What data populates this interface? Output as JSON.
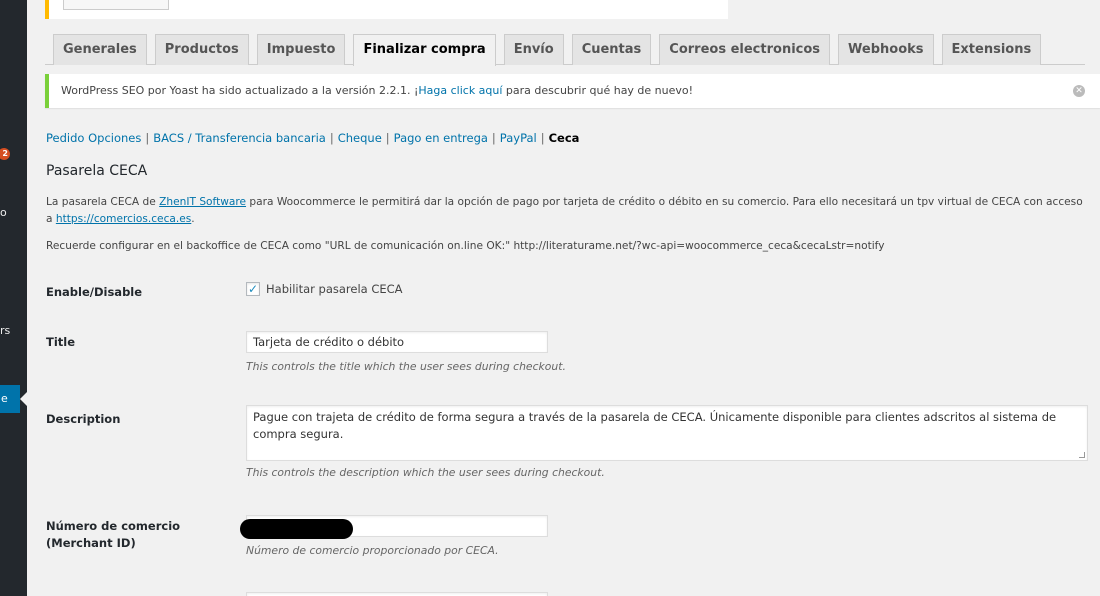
{
  "sidebar": {
    "badge_count": "2",
    "fragments": [
      "o",
      "rs"
    ],
    "active_fragment": "e"
  },
  "tabs": [
    {
      "label": "Generales",
      "active": false
    },
    {
      "label": "Productos",
      "active": false
    },
    {
      "label": "Impuesto",
      "active": false
    },
    {
      "label": "Finalizar compra",
      "active": true
    },
    {
      "label": "Envío",
      "active": false
    },
    {
      "label": "Cuentas",
      "active": false
    },
    {
      "label": "Correos electronicos",
      "active": false
    },
    {
      "label": "Webhooks",
      "active": false
    },
    {
      "label": "Extensions",
      "active": false
    }
  ],
  "notice": {
    "before": "WordPress SEO por Yoast ha sido actualizado a la versión 2.2.1. ¡",
    "link": "Haga click aquí",
    "after": " para descubrir qué hay de nuevo!",
    "dismiss_icon": "dismiss-icon",
    "border_color": "#7ad03a"
  },
  "subnav": {
    "items": [
      "Pedido Opciones",
      "BACS / Transferencia bancaria",
      "Cheque",
      "Pago en entrega",
      "PayPal"
    ],
    "current": "Ceca",
    "separator": "|"
  },
  "heading": "Pasarela CECA",
  "intro": {
    "p1_before": "La pasarela CECA de ",
    "p1_link": "ZhenIT Software",
    "p1_middle": " para Woocommerce le permitirá dar la opción de pago por tarjeta de crédito o débito en su comercio. Para ello necesitará un tpv virtual de CECA con acceso a ",
    "p1_url": "https://comercios.ceca.es",
    "p1_end": ".",
    "p2": "Recuerde configurar en el backoffice de CECA como \"URL de comunicación on.line OK:\" http://literaturame.net/?wc-api=woocommerce_ceca&cecaLstr=notify"
  },
  "fields": {
    "enable": {
      "label": "Enable/Disable",
      "checkbox_label": "Habilitar pasarela CECA",
      "checked": true
    },
    "title": {
      "label": "Title",
      "value": "Tarjeta de crédito o débito",
      "help": "This controls the title which the user sees during checkout."
    },
    "description": {
      "label": "Description",
      "value": "Pague con trajeta de crédito de forma segura a través de la pasarela de CECA. Únicamente disponible para clientes adscritos al sistema de compra segura.",
      "help": "This controls the description which the user sees during checkout."
    },
    "merchant": {
      "label_line1": "Número de comercio",
      "label_line2": "(Merchant ID)",
      "help": "Número de comercio proporcionado por CECA."
    }
  }
}
